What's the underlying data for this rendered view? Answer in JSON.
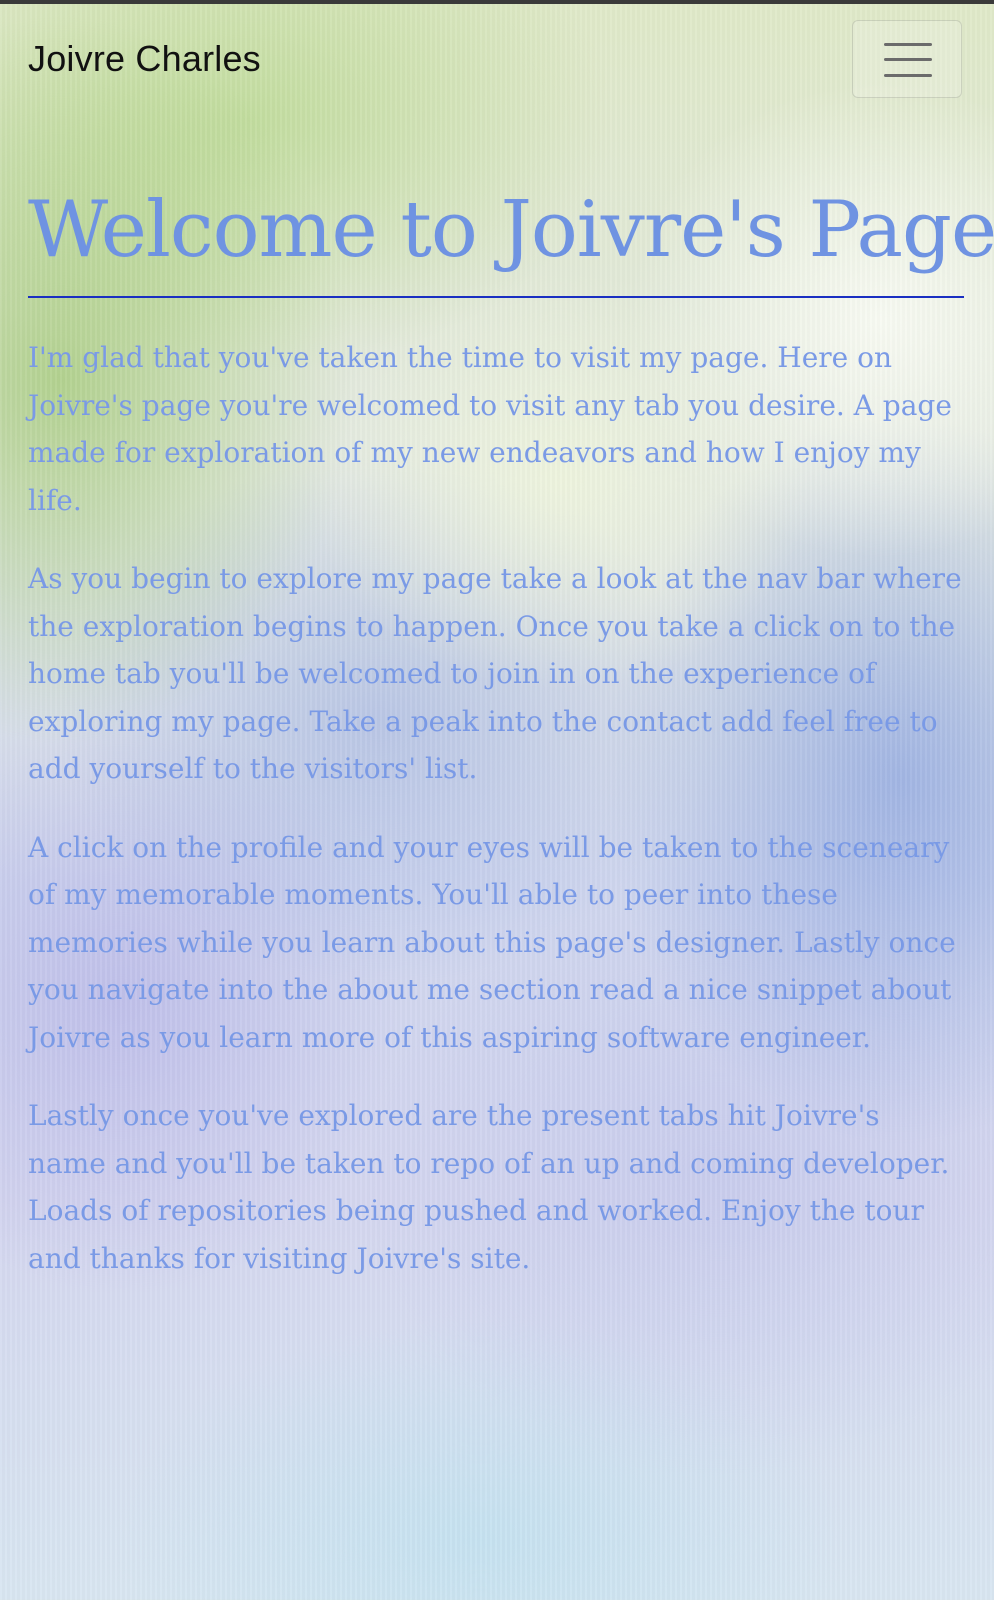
{
  "navbar": {
    "brand": "Joivre Charles",
    "toggler_icon": "hamburger-menu-icon"
  },
  "main": {
    "title": "Welcome to Joivre's Page",
    "paragraphs": [
      "I'm glad that you've taken the time to visit my page. Here on Joivre's page you're welcomed to visit any tab you desire. A page made for exploration of my new endeavors and how I enjoy my life.",
      "As you begin to explore my page take a look at the nav bar where the exploration begins to happen. Once you take a click on to the home tab you'll be welcomed to join in on the experience of exploring my page. Take a peak into the contact add feel free to add yourself to the visitors' list.",
      "A click on the profile and your eyes will be taken to the sceneary of my memorable moments. You'll able to peer into these memories while you learn about this page's designer. Lastly once you navigate into the about me section read a nice snippet about Joivre as you learn more of this aspiring software engineer.",
      "Lastly once you've explored are the present tabs hit Joivre's name and you'll be taken to repo of an up and coming developer. Loads of repositories being pushed and worked. Enjoy the tour and thanks for visiting Joivre's site."
    ]
  },
  "colors": {
    "heading_text": "#6f93e2",
    "body_text": "#7a9ae6",
    "divider": "#1a2fc2",
    "brand_text": "#111111"
  }
}
